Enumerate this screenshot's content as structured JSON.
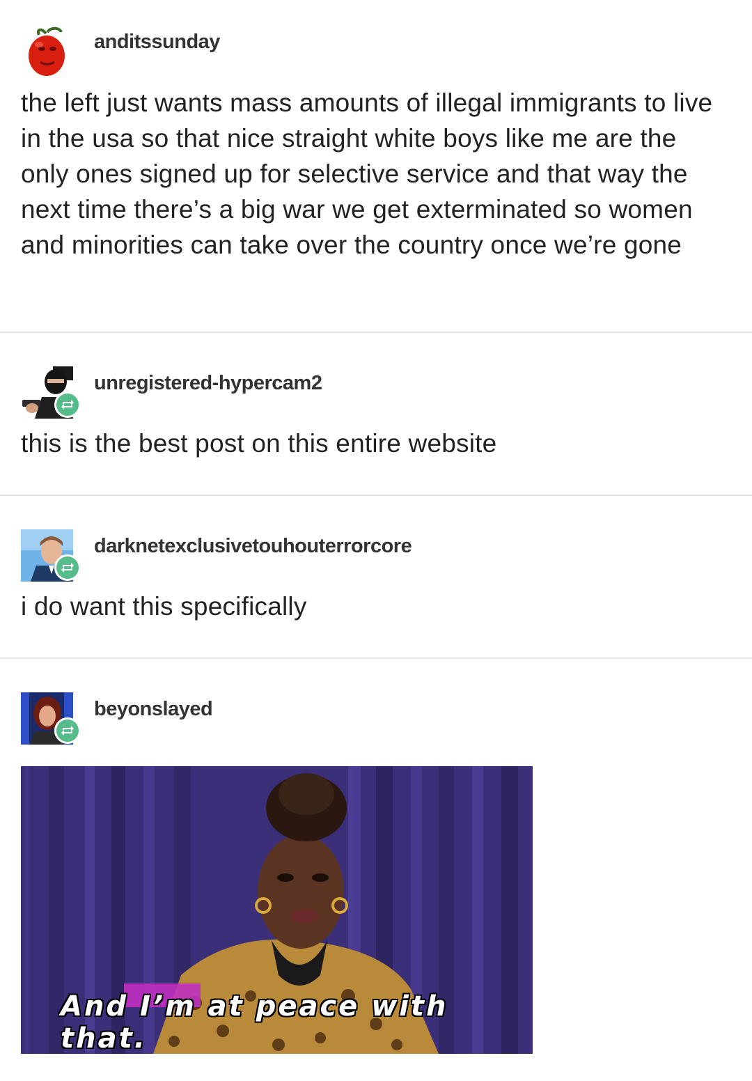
{
  "posts": [
    {
      "username": "anditssunday",
      "avatar_icon": "red-pepper-face-avatar",
      "is_reblog": false,
      "text": "the left just wants mass amounts of illegal immigrants to live in the usa so that nice straight white boys like me are the only ones signed up for selective service and that way the next time there’s a big war we get exterminated so women and minorities can take over the country once we’re gone"
    },
    {
      "username": "unregistered-hypercam2",
      "avatar_icon": "masked-man-avatar",
      "is_reblog": true,
      "text": "this is the best post on this entire website"
    },
    {
      "username": "darknetexclusivetouhouterrorcore",
      "avatar_icon": "smiling-man-avatar",
      "is_reblog": true,
      "text": "i do want this specifically"
    },
    {
      "username": "beyonslayed",
      "avatar_icon": "woman-portrait-avatar",
      "is_reblog": true,
      "gif_caption": "And I’m at peace with that."
    }
  ],
  "colors": {
    "reblog_badge": "#56bc8a",
    "divider": "#e2e2e2",
    "gif_curtain": "#3c2f7a"
  }
}
